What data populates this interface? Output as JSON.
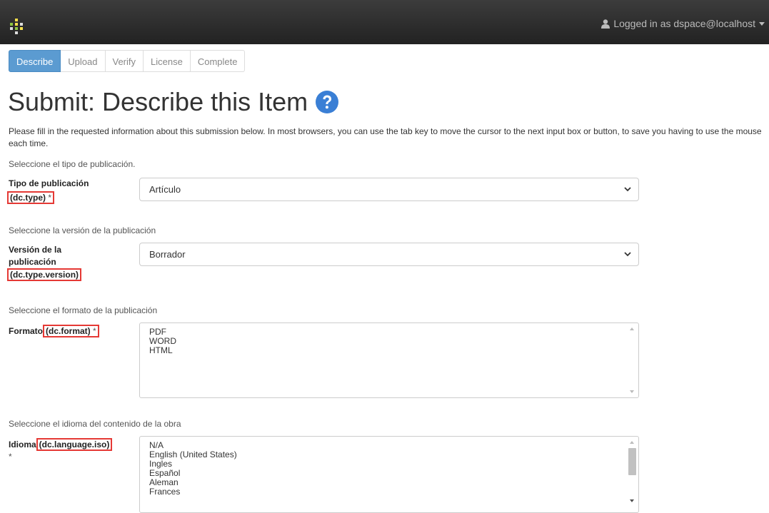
{
  "header": {
    "user_label": "Logged in as dspace@localhost"
  },
  "steps": [
    {
      "label": "Describe",
      "active": true
    },
    {
      "label": "Upload"
    },
    {
      "label": "Verify"
    },
    {
      "label": "License"
    },
    {
      "label": "Complete"
    }
  ],
  "page": {
    "title": "Submit: Describe this Item",
    "intro": "Please fill in the requested information about this submission below. In most browsers, you can use the tab key to move the cursor to the next input box or button, to save you having to use the mouse each time."
  },
  "fields": {
    "type": {
      "hint": "Seleccione el tipo de publicación.",
      "label": "Tipo de publicación",
      "code": "(dc.type)",
      "required": "*",
      "value": "Artículo"
    },
    "version": {
      "hint": "Seleccione la versión de la publicación",
      "label_line1": "Versión de la",
      "label_line2": "publicación",
      "code": "(dc.type.version)",
      "value": "Borrador"
    },
    "format": {
      "hint": "Seleccione el formato de la publicación",
      "label": "Formato",
      "code": "(dc.format)",
      "required": "*",
      "options": [
        "PDF",
        "WORD",
        "HTML"
      ]
    },
    "language": {
      "hint": "Seleccione el idioma del contenido de la obra",
      "label": "Idioma",
      "code": "(dc.language.iso)",
      "required": "*",
      "options": [
        "N/A",
        "English (United States)",
        "Ingles",
        "Español",
        "Aleman",
        "Frances"
      ]
    }
  },
  "icons": {
    "logo": "dspace-logo-icon",
    "user": "user-icon",
    "caret": "caret-down-icon",
    "help": "question-circle-icon",
    "select_chevron": "chevron-down-icon"
  },
  "colors": {
    "navbar": "#222222",
    "active_step": "#5b9bd1",
    "help_icon": "#3a7fd5",
    "highlight_box": "#e53935"
  }
}
